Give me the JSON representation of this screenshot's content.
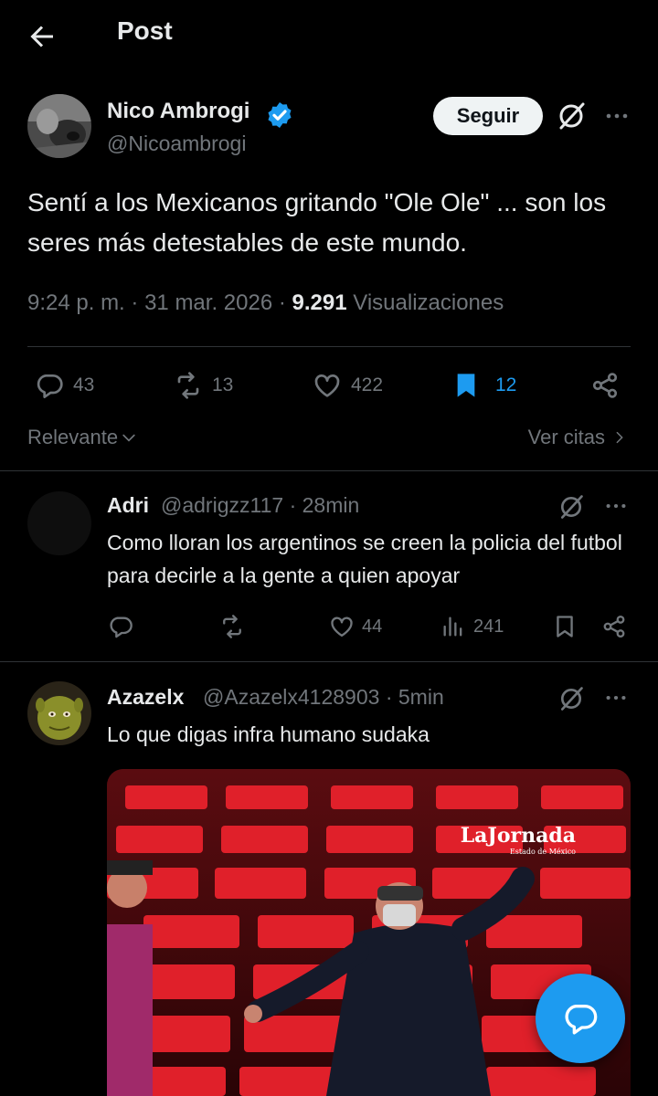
{
  "header": {
    "title": "Post",
    "back_icon": "arrow-left-icon"
  },
  "post": {
    "author": {
      "name": "Nico Ambrogi",
      "handle": "@Nicoambrogi",
      "verified_icon": "verified-badge-icon"
    },
    "follow_label": "Seguir",
    "text": "Sentí a los Mexicanos gritando \"Ole Ole\" ... son los seres más detestables de este mundo.",
    "time": "9:24 p. m.",
    "date": "31 mar. 2026",
    "views_count": "9.291",
    "views_label": "Visualizaciones",
    "separator": "·",
    "stats": {
      "replies": "43",
      "reposts": "13",
      "likes": "422",
      "bookmarks": "12"
    },
    "bookmarked": true
  },
  "sort": {
    "label": "Relevante",
    "quotes_label": "Ver citas"
  },
  "replies": [
    {
      "name": "Adri",
      "handle": "@adrigzz117",
      "separator": "·",
      "time": "28min",
      "text": "Como lloran los argentinos se creen la policia del futbol para decirle a la gente a quien apoyar",
      "stats": {
        "likes": "44",
        "views": "241"
      }
    },
    {
      "name": "Azazelx",
      "handle": "@Azazelx4128903",
      "separator": "·",
      "time": "5min",
      "text": "Lo que digas infra humano sudaka",
      "media_watermark": "LaJornada",
      "media_watermark_sub": "Estado de México"
    }
  ],
  "colors": {
    "background": "#000000",
    "text": "#e7e9ea",
    "muted": "#71767b",
    "accent": "#1d9bf0",
    "divider": "#2f3336"
  },
  "icons": [
    "arrow-left-icon",
    "verified-badge-icon",
    "grok-icon",
    "more-icon",
    "reply-icon",
    "repost-icon",
    "like-icon",
    "bookmark-icon",
    "share-icon",
    "views-icon",
    "chevron-down-icon",
    "chevron-right-icon",
    "compose-reply-icon"
  ]
}
